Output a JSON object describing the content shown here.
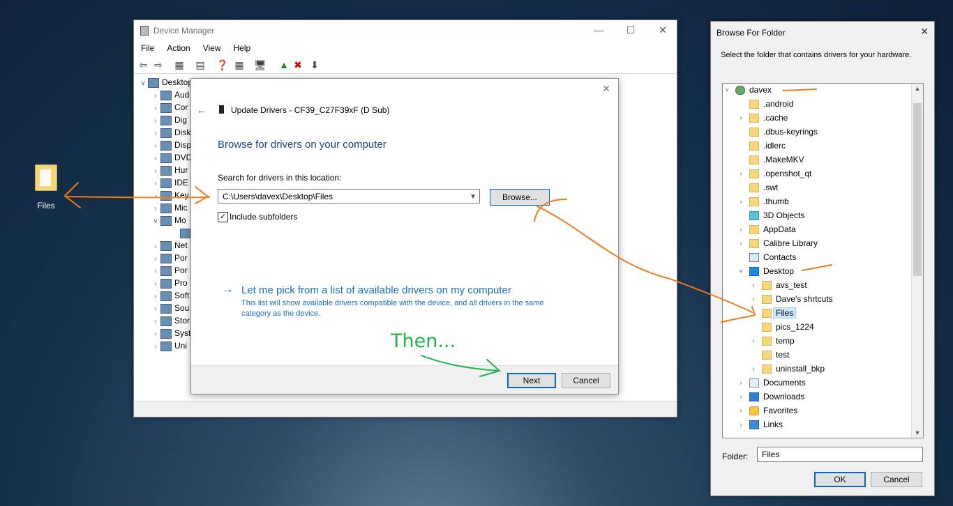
{
  "desktop": {
    "icon_label": "Files"
  },
  "device_manager": {
    "title": "Device Manager",
    "menu": [
      "File",
      "Action",
      "View",
      "Help"
    ],
    "tree_root": "Desktop",
    "tree_items": [
      "Aud",
      "Cor",
      "Dig",
      "Disk",
      "Disp",
      "DVD",
      "Hur",
      "IDE",
      "Key",
      "Mic",
      "Mo",
      "",
      "Net",
      "Por",
      "Por",
      "Pro",
      "Soft",
      "Sou",
      "Stor",
      "Syst",
      "Uni"
    ]
  },
  "update_drivers": {
    "dialog_title": "Update Drivers - CF39_C27F39xF (D Sub)",
    "heading": "Browse for drivers on your computer",
    "search_label": "Search for drivers in this location:",
    "path_value": "C:\\Users\\davex\\Desktop\\Files",
    "browse_label": "Browse...",
    "include_subfolders": "Include subfolders",
    "pick_link": "Let me pick from a list of available drivers on my computer",
    "pick_desc": "This list will show available drivers compatible with the device, and all drivers in the same category as the device.",
    "next_label": "Next",
    "cancel_label": "Cancel"
  },
  "annotation": {
    "then_text": "Then..."
  },
  "browse_folder": {
    "title": "Browse For Folder",
    "instruction": "Select the folder that contains drivers for your hardware.",
    "items": [
      {
        "label": "davex",
        "icon": "user-icon",
        "chev": "˅"
      },
      {
        "label": ".android",
        "icon": "folder-icon",
        "chev": ""
      },
      {
        "label": ".cache",
        "icon": "folder-icon",
        "chev": "›"
      },
      {
        "label": ".dbus-keyrings",
        "icon": "folder-icon",
        "chev": ""
      },
      {
        "label": ".idlerc",
        "icon": "folder-icon",
        "chev": ""
      },
      {
        "label": ".MakeMKV",
        "icon": "folder-icon",
        "chev": ""
      },
      {
        "label": ".openshot_qt",
        "icon": "folder-icon",
        "chev": "›"
      },
      {
        "label": ".swt",
        "icon": "folder-icon",
        "chev": ""
      },
      {
        "label": ".thumb",
        "icon": "folder-icon",
        "chev": "›"
      },
      {
        "label": "3D Objects",
        "icon": "cube-icon",
        "chev": ""
      },
      {
        "label": "AppData",
        "icon": "folder-icon",
        "chev": "›"
      },
      {
        "label": "Calibre Library",
        "icon": "folder-icon",
        "chev": "›"
      },
      {
        "label": "Contacts",
        "icon": "contacts-icon",
        "chev": ""
      },
      {
        "label": "Desktop",
        "icon": "desktop-icon",
        "chev": "˅"
      },
      {
        "label": "avs_test",
        "icon": "folder-icon",
        "chev": "›"
      },
      {
        "label": "Dave's shrtcuts",
        "icon": "folder-icon",
        "chev": "›"
      },
      {
        "label": "Files",
        "icon": "folder-icon",
        "chev": ""
      },
      {
        "label": "pics_1224",
        "icon": "folder-icon",
        "chev": ""
      },
      {
        "label": "temp",
        "icon": "folder-icon",
        "chev": "›"
      },
      {
        "label": "test",
        "icon": "folder-icon",
        "chev": ""
      },
      {
        "label": "uninstall_bkp",
        "icon": "folder-icon",
        "chev": "›"
      },
      {
        "label": "Documents",
        "icon": "documents-icon",
        "chev": "›"
      },
      {
        "label": "Downloads",
        "icon": "downloads-icon",
        "chev": "›"
      },
      {
        "label": "Favorites",
        "icon": "favorites-icon",
        "chev": "›"
      },
      {
        "label": "Links",
        "icon": "links-icon",
        "chev": "›"
      }
    ],
    "folder_label": "Folder:",
    "folder_value": "Files",
    "ok_label": "OK",
    "cancel_label": "Cancel"
  },
  "colors": {
    "arrow_orange": "#f07b1e",
    "arrow_green": "#22b24c",
    "accent_blue": "#0a64c8",
    "link_blue": "#1a6fbf"
  }
}
